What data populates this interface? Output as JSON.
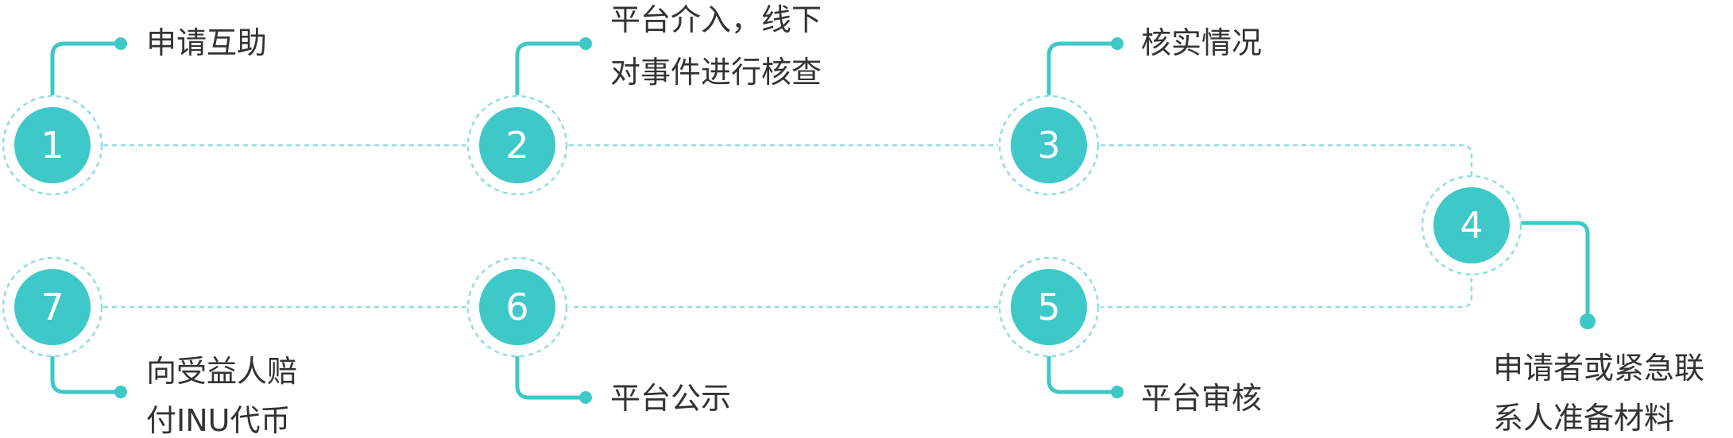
{
  "colors": {
    "accent": "#3ec8c8",
    "dashed_line": "#8fdede",
    "label_text": "#333333",
    "number_text": "#ffffff"
  },
  "steps": [
    {
      "number": "1",
      "lines": [
        "申请互助"
      ]
    },
    {
      "number": "2",
      "lines": [
        "平台介入，线下",
        "对事件进行核查"
      ]
    },
    {
      "number": "3",
      "lines": [
        "核实情况"
      ]
    },
    {
      "number": "4",
      "lines": [
        "申请者或紧急联",
        "系人准备材料"
      ]
    },
    {
      "number": "5",
      "lines": [
        "平台审核"
      ]
    },
    {
      "number": "6",
      "lines": [
        "平台公示"
      ]
    },
    {
      "number": "7",
      "lines": [
        "向受益人赔",
        "付INU代币"
      ]
    }
  ]
}
